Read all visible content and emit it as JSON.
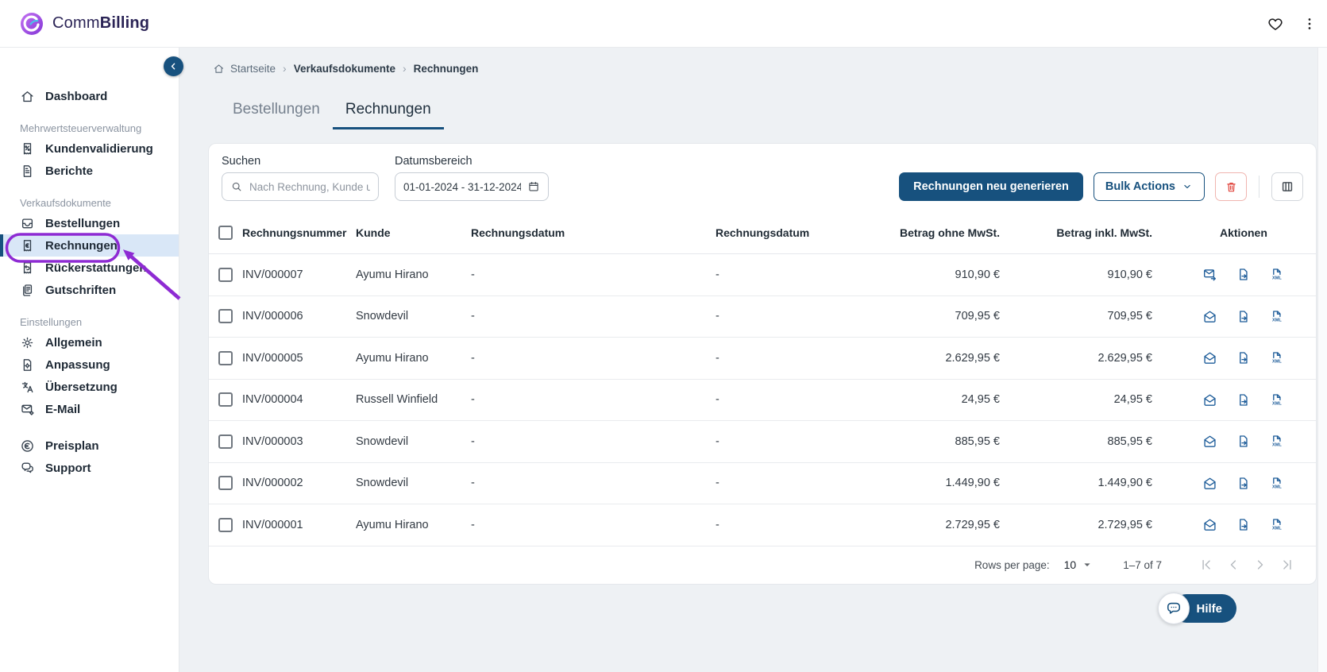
{
  "colors": {
    "primary": "#17517E",
    "link_blue": "#1D5C99",
    "danger": "#E0443C",
    "annotation": "#8E2BD3",
    "active_item_bg": "#D9E7F7",
    "content_bg": "#EEF1F4"
  },
  "topbar": {
    "brand_prefix": "Comm",
    "brand_suffix": "Billing"
  },
  "sidebar": {
    "sections": [
      {
        "label": "",
        "items": [
          {
            "label": "Dashboard",
            "icon": "home",
            "active": false
          }
        ]
      },
      {
        "label": "Mehrwertsteuerverwaltung",
        "items": [
          {
            "label": "Kundenvalidierung",
            "icon": "receipt-percent",
            "active": false
          },
          {
            "label": "Berichte",
            "icon": "report-doc",
            "active": false
          }
        ]
      },
      {
        "label": "Verkaufsdokumente",
        "items": [
          {
            "label": "Bestellungen",
            "icon": "orders-inbox",
            "active": false
          },
          {
            "label": "Rechnungen",
            "icon": "invoice-receipt",
            "active": true
          },
          {
            "label": "Rückerstattungen",
            "icon": "refund-receipt",
            "active": false
          },
          {
            "label": "Gutschriften",
            "icon": "credit-note",
            "active": false
          }
        ]
      },
      {
        "label": "Einstellungen",
        "items": [
          {
            "label": "Allgemein",
            "icon": "gear",
            "active": false
          },
          {
            "label": "Anpassung",
            "icon": "customize-doc",
            "active": false
          },
          {
            "label": "Übersetzung",
            "icon": "translate",
            "active": false
          },
          {
            "label": "E-Mail",
            "icon": "mail-gear",
            "active": false
          }
        ]
      },
      {
        "label": "",
        "items": [
          {
            "label": "Preisplan",
            "icon": "euro-circle",
            "active": false
          },
          {
            "label": "Support",
            "icon": "support-chat",
            "active": false
          }
        ]
      }
    ]
  },
  "breadcrumb": {
    "items": [
      {
        "label": "Startseite",
        "bold": false,
        "icon": "home"
      },
      {
        "label": "Verkaufsdokumente",
        "bold": true
      },
      {
        "label": "Rechnungen",
        "bold": true
      }
    ]
  },
  "tabs": [
    {
      "label": "Bestellungen",
      "active": false
    },
    {
      "label": "Rechnungen",
      "active": true
    }
  ],
  "toolbar": {
    "search_label": "Suchen",
    "search_placeholder": "Nach Rechnung, Kunde u",
    "date_label": "Datumsbereich",
    "date_value": "01-01-2024 - 31-12-2024",
    "primary_button": "Rechnungen neu generieren",
    "bulk_button": "Bulk Actions"
  },
  "table": {
    "columns": [
      "Rechnungsnummer",
      "Kunde",
      "Rechnungsdatum",
      "Rechnungsdatum",
      "Betrag ohne MwSt.",
      "Betrag inkl. MwSt.",
      "Aktionen"
    ],
    "rows": [
      {
        "number": "INV/000007",
        "customer": "Ayumu Hirano",
        "date1": "-",
        "date2": "-",
        "net": "910,90 €",
        "gross": "910,90 €",
        "mail_icon": "mail-send"
      },
      {
        "number": "INV/000006",
        "customer": "Snowdevil",
        "date1": "-",
        "date2": "-",
        "net": "709,95 €",
        "gross": "709,95 €",
        "mail_icon": "mail-open"
      },
      {
        "number": "INV/000005",
        "customer": "Ayumu Hirano",
        "date1": "-",
        "date2": "-",
        "net": "2.629,95 €",
        "gross": "2.629,95 €",
        "mail_icon": "mail-open"
      },
      {
        "number": "INV/000004",
        "customer": "Russell Winfield",
        "date1": "-",
        "date2": "-",
        "net": "24,95 €",
        "gross": "24,95 €",
        "mail_icon": "mail-open"
      },
      {
        "number": "INV/000003",
        "customer": "Snowdevil",
        "date1": "-",
        "date2": "-",
        "net": "885,95 €",
        "gross": "885,95 €",
        "mail_icon": "mail-open"
      },
      {
        "number": "INV/000002",
        "customer": "Snowdevil",
        "date1": "-",
        "date2": "-",
        "net": "1.449,90 €",
        "gross": "1.449,90 €",
        "mail_icon": "mail-open"
      },
      {
        "number": "INV/000001",
        "customer": "Ayumu Hirano",
        "date1": "-",
        "date2": "-",
        "net": "2.729,95 €",
        "gross": "2.729,95 €",
        "mail_icon": "mail-open"
      }
    ]
  },
  "pagination": {
    "rows_per_page_label": "Rows per page:",
    "rows_per_page_value": "10",
    "range_label": "1–7 of 7"
  },
  "help": {
    "label": "Hilfe"
  }
}
